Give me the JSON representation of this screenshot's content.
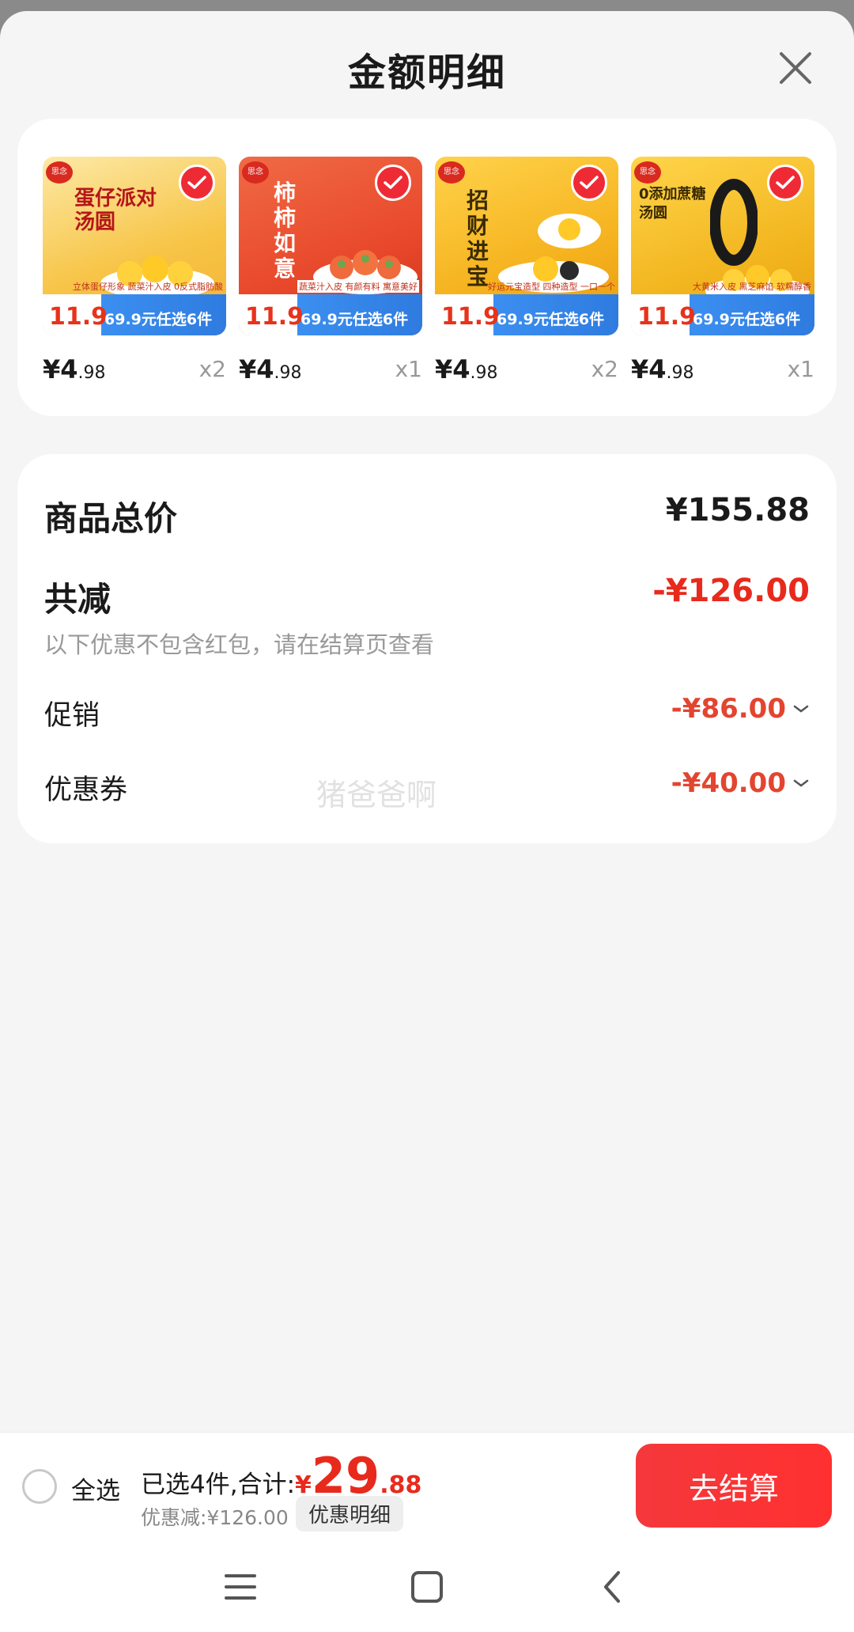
{
  "sheet": {
    "title": "金额明细",
    "close_icon": "close-icon"
  },
  "products": [
    {
      "name": "蛋仔派对 汤圆",
      "feature": "立体蛋仔形象 蔬菜汁入皮 0反式脂肪酸",
      "promo_price": "11.9",
      "promo": "69.9元任选6件",
      "price_int": "¥4",
      "price_dec": ".98",
      "qty": "x2",
      "color": "#f7c548",
      "checked": true
    },
    {
      "name": "柿柿如意",
      "feature": "蔬菜汁入皮 有颜有料 寓意美好",
      "promo_price": "11.9",
      "promo": "69.9元任选6件",
      "price_int": "¥4",
      "price_dec": ".98",
      "qty": "x1",
      "color": "#e8472a",
      "checked": true
    },
    {
      "name": "招财进宝",
      "feature": "好运元宝造型 四种造型 一口一个",
      "promo_price": "11.9",
      "promo": "69.9元任选6件",
      "price_int": "¥4",
      "price_dec": ".98",
      "qty": "x2",
      "color": "#f5b21e",
      "checked": true
    },
    {
      "name": "0添加蔗糖 汤圆",
      "feature": "大黄米入皮 黑芝麻馅 软糯醇香",
      "promo_price": "11.9",
      "promo": "69.9元任选6件",
      "price_int": "¥4",
      "price_dec": ".98",
      "qty": "x1",
      "color": "#f2b51f",
      "checked": true
    }
  ],
  "summary": {
    "total_label": "商品总价",
    "total_value": "¥155.88",
    "reduce_label": "共减",
    "reduce_value": "-¥126.00",
    "note": "以下优惠不包含红包，请在结算页查看",
    "promo_label": "促销",
    "promo_value": "-¥86.00",
    "coupon_label": "优惠券",
    "coupon_value": "-¥40.00",
    "watermark": "猪爸爸啊"
  },
  "bottom": {
    "select_all": "全选",
    "selected_text": "已选4件,合计:",
    "currency": "¥",
    "total_int": "29",
    "total_dec": ".88",
    "discount_text": "优惠减:¥126.00",
    "detail_button": "优惠明细",
    "checkout_button": "去结算"
  },
  "colors": {
    "accent": "#e82a1c",
    "checkout_bg": "#f4383c",
    "background": "#f5f5f5"
  }
}
